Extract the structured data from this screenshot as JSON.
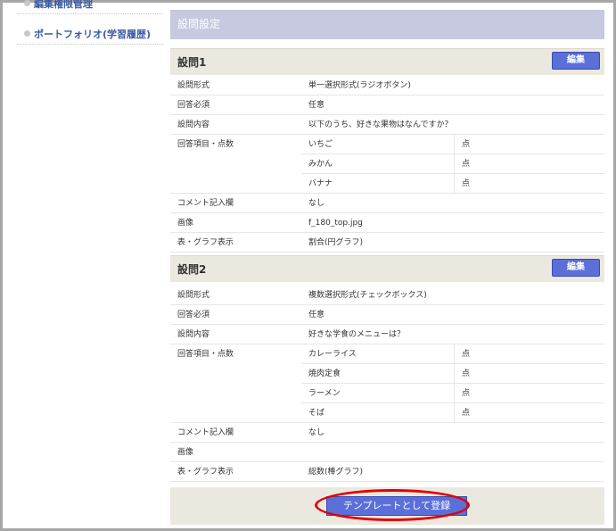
{
  "sidebar": {
    "items": [
      {
        "label": "編集権限管理"
      },
      {
        "label": "ポートフォリオ(学習履歴)"
      }
    ]
  },
  "main": {
    "header_title": "設問設定",
    "questions": [
      {
        "title": "設問1",
        "edit_label": "編集",
        "rows": {
          "format_label": "設問形式",
          "format_value": "単一選択形式(ラジオボタン)",
          "required_label": "回答必須",
          "required_value": "任意",
          "content_label": "設問内容",
          "content_value": "以下のうち、好きな果物はなんですか？",
          "options_label": "回答項目・点数",
          "options": [
            {
              "text": "いちご",
              "points": "点"
            },
            {
              "text": "みかん",
              "points": "点"
            },
            {
              "text": "バナナ",
              "points": "点"
            }
          ],
          "comment_label": "コメント記入欄",
          "comment_value": "なし",
          "image_label": "画像",
          "image_value": "f_180_top.jpg",
          "graph_label": "表・グラフ表示",
          "graph_value": "割合(円グラフ)"
        }
      },
      {
        "title": "設問2",
        "edit_label": "編集",
        "rows": {
          "format_label": "設問形式",
          "format_value": "複数選択形式(チェックボックス)",
          "required_label": "回答必須",
          "required_value": "任意",
          "content_label": "設問内容",
          "content_value": "好きな学食のメニューは？",
          "options_label": "回答項目・点数",
          "options": [
            {
              "text": "カレーライス",
              "points": "点"
            },
            {
              "text": "焼肉定食",
              "points": "点"
            },
            {
              "text": "ラーメン",
              "points": "点"
            },
            {
              "text": "そば",
              "points": "点"
            }
          ],
          "comment_label": "コメント記入欄",
          "comment_value": "なし",
          "image_label": "画像",
          "image_value": "",
          "graph_label": "表・グラフ表示",
          "graph_value": "総数(棒グラフ)"
        }
      }
    ],
    "register_label": "テンプレートとして登録"
  },
  "colors": {
    "header_bg": "#c7c9e0",
    "section_bg": "#ebe8df",
    "button_bg": "#5b6fd9",
    "highlight": "#e00000",
    "sidebar_link": "#3b5aa5"
  }
}
